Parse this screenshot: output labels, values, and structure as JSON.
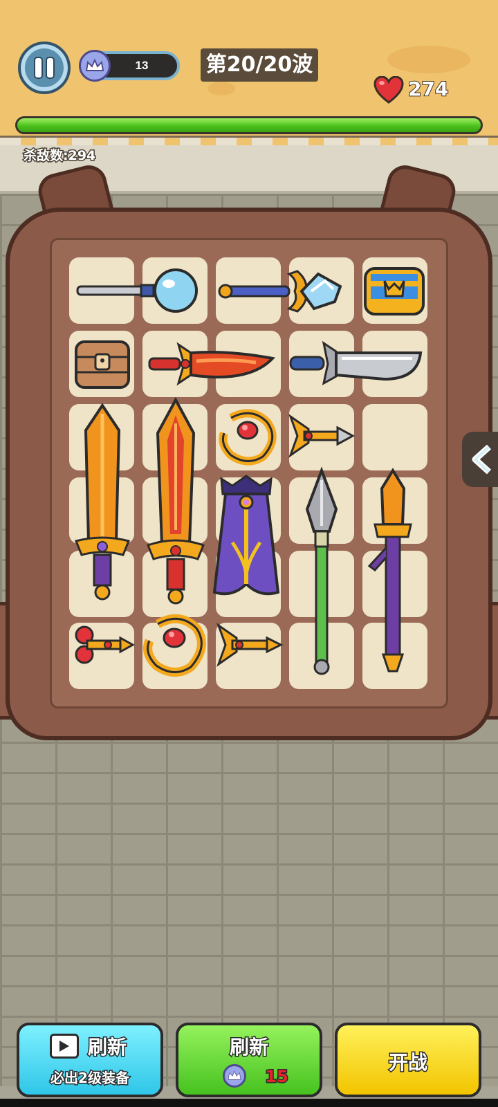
{
  "hud": {
    "crown_count": "13",
    "wave_label": "第20/20波",
    "health": "274",
    "kill_count_label": "杀敌数:294",
    "wave_progress": 1.0
  },
  "backpack": {
    "grid": {
      "columns": 5,
      "rows": 6
    },
    "items": [
      {
        "name": "magic-staff-orb",
        "icon": "blue-orb-staff-icon"
      },
      {
        "name": "crystal-scepter",
        "icon": "crystal-scepter-icon"
      },
      {
        "name": "treasure-chest-blue",
        "icon": "blue-chest-icon"
      },
      {
        "name": "wooden-chest",
        "icon": "wooden-chest-icon"
      },
      {
        "name": "flame-dagger",
        "icon": "flame-dagger-icon"
      },
      {
        "name": "steel-machete",
        "icon": "machete-icon"
      },
      {
        "name": "golden-broadsword",
        "icon": "golden-sword-icon"
      },
      {
        "name": "flame-greatsword",
        "icon": "flame-greatsword-icon"
      },
      {
        "name": "golden-ring",
        "icon": "ruby-ring-icon"
      },
      {
        "name": "golden-arrow",
        "icon": "arrow-icon"
      },
      {
        "name": "royal-cape",
        "icon": "purple-cape-icon"
      },
      {
        "name": "green-spear",
        "icon": "spear-icon"
      },
      {
        "name": "purple-staff",
        "icon": "gold-tipped-staff-icon"
      },
      {
        "name": "red-key-dart",
        "icon": "key-dart-icon"
      },
      {
        "name": "golden-ring-2",
        "icon": "ruby-ring-icon"
      },
      {
        "name": "golden-dart",
        "icon": "dart-icon"
      }
    ]
  },
  "buttons": {
    "ad_refresh": {
      "label": "刷新",
      "sub": "必出2级装备",
      "icon": "video-play-icon"
    },
    "refresh": {
      "label": "刷新",
      "cost": "15",
      "icon": "crown-coin-icon"
    },
    "start": {
      "label": "开战"
    }
  },
  "colors": {
    "sand": "#f0c46e",
    "backpack": "#8c5a48",
    "cell": "#efe3c8",
    "progress_green": "#4cc11d",
    "ad_button": "#2fc6e8",
    "refresh_button": "#46c21f",
    "start_button": "#f2c400"
  }
}
